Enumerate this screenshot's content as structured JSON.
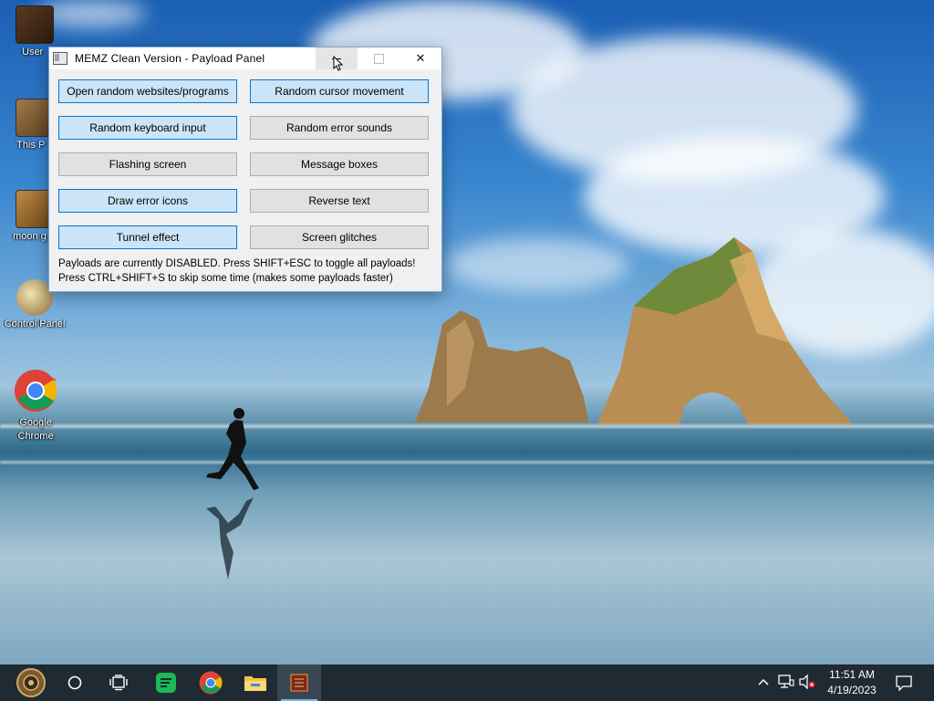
{
  "desktop": {
    "icons": [
      {
        "label": "User"
      },
      {
        "label": "This P"
      },
      {
        "label": "moon g"
      },
      {
        "label": "Control Panel"
      },
      {
        "label": "Google Chrome"
      }
    ]
  },
  "window": {
    "title": "MEMZ Clean Version - Payload Panel",
    "caption_minimize": "",
    "caption_maximize": "",
    "caption_close": "✕",
    "buttons": [
      {
        "label": "Open random websites/programs",
        "enabled": true
      },
      {
        "label": "Random cursor movement",
        "enabled": true
      },
      {
        "label": "Random keyboard input",
        "enabled": true
      },
      {
        "label": "Random error sounds",
        "enabled": false
      },
      {
        "label": "Flashing screen",
        "enabled": false
      },
      {
        "label": "Message boxes",
        "enabled": false
      },
      {
        "label": "Draw error icons",
        "enabled": true
      },
      {
        "label": "Reverse text",
        "enabled": false
      },
      {
        "label": "Tunnel effect",
        "enabled": true
      },
      {
        "label": "Screen glitches",
        "enabled": false
      }
    ],
    "info_line1": "Payloads are currently DISABLED. Press SHIFT+ESC to toggle all payloads!",
    "info_line2": "Press CTRL+SHIFT+S to skip some time (makes some payloads faster)"
  },
  "taskbar": {
    "items": [
      "start-icon",
      "search-circle-icon",
      "task-view-icon",
      "notes-app-icon",
      "chrome-icon",
      "file-explorer-icon",
      "memz-app-icon"
    ],
    "tray_chevron": "^",
    "time": "11:51 AM",
    "date": "4/19/2023"
  },
  "colors": {
    "button_on": "#cce4f7",
    "button_on_border": "#0078d7",
    "button_off": "#e1e1e1",
    "taskbar": "#1f2a33"
  }
}
